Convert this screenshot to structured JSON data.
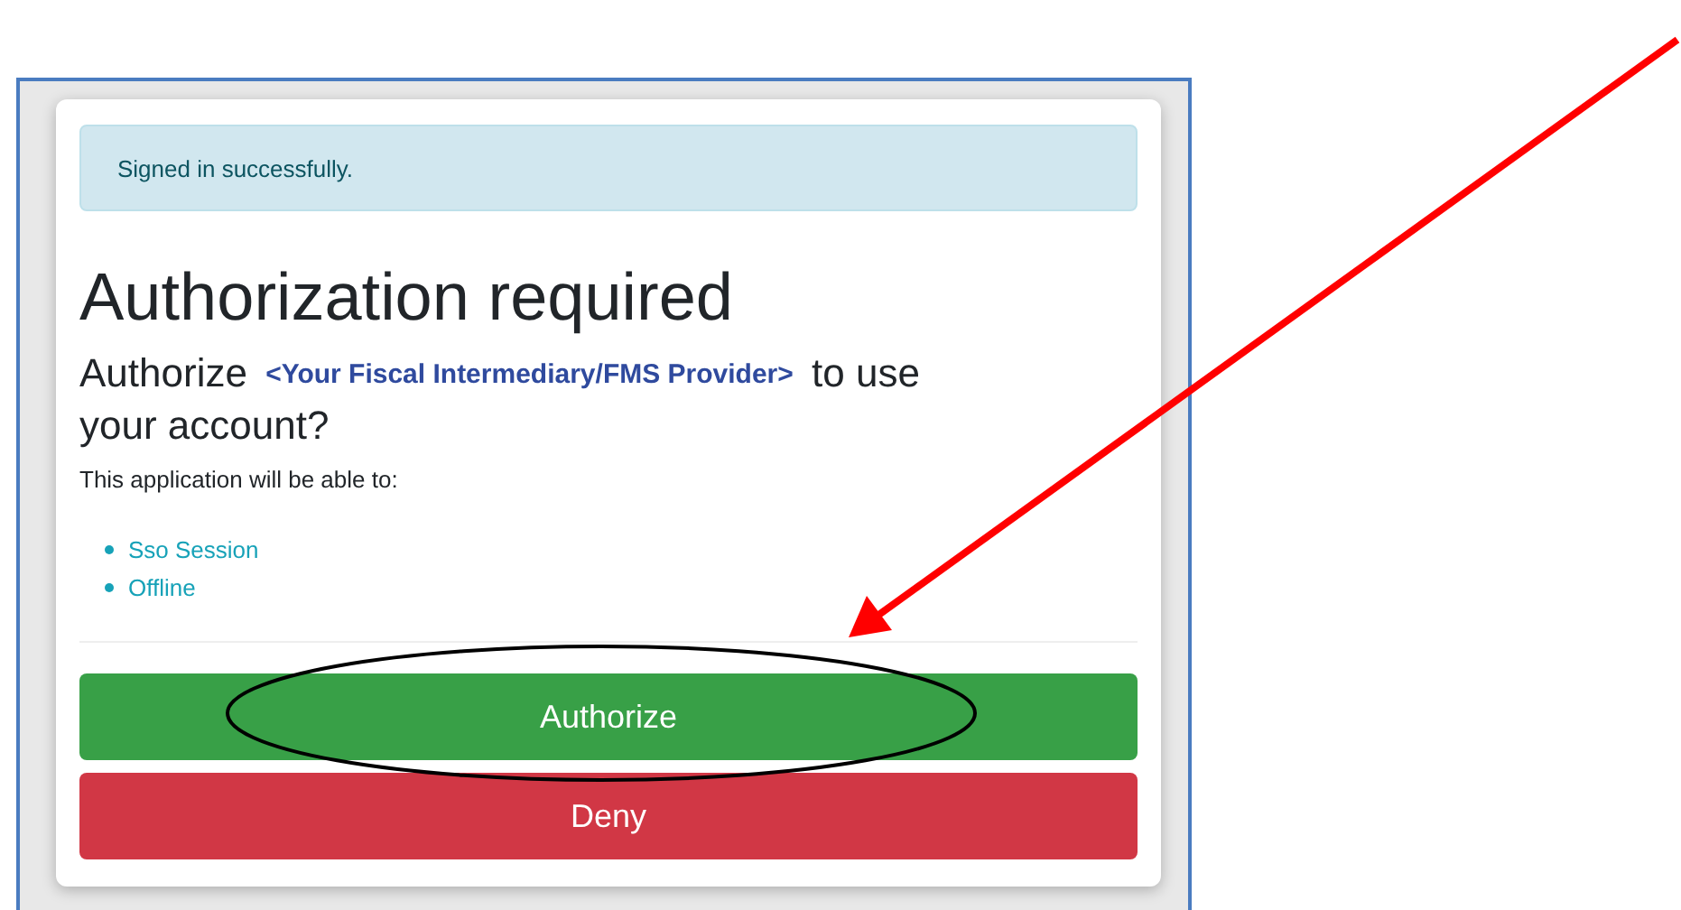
{
  "alert": {
    "text": "Signed in successfully."
  },
  "title": "Authorization required",
  "question": {
    "prefix": "Authorize",
    "client": "<Your Fiscal Intermediary/FMS Provider>",
    "suffix": "to use your account?"
  },
  "intro": "This application will be able to:",
  "scopes": [
    "Sso Session",
    "Offline"
  ],
  "buttons": [
    {
      "label": "Authorize",
      "kind": "primary"
    },
    {
      "label": "Deny",
      "kind": "danger"
    }
  ],
  "callouts": {
    "arrow": true,
    "ellipse": true
  }
}
